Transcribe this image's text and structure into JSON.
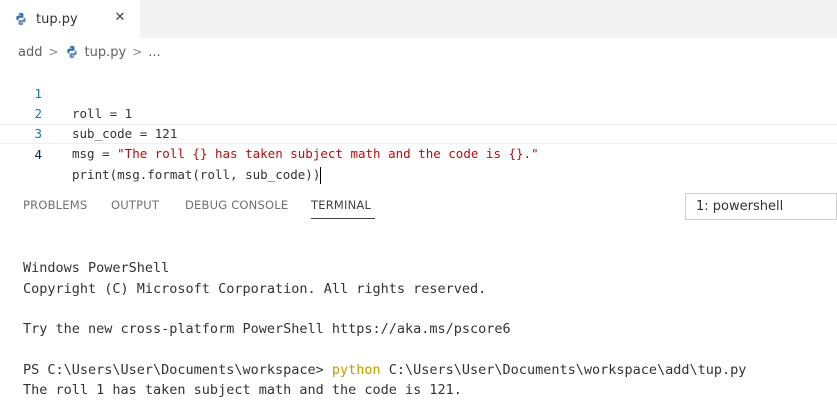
{
  "tab": {
    "filename": "tup.py",
    "close_glyph": "✕"
  },
  "breadcrumb": {
    "folder": "add",
    "file": "tup.py",
    "more": "...",
    "separator": ">"
  },
  "editor": {
    "lines": [
      {
        "number": "1",
        "code": "roll = 1"
      },
      {
        "number": "2",
        "code": "sub_code = 121"
      },
      {
        "number": "3",
        "code_prefix": "msg = ",
        "string": "\"The roll {} has taken subject math and the code is {}.\""
      },
      {
        "number": "4",
        "code": "print(msg.format(roll, sub_code))"
      }
    ]
  },
  "panel": {
    "tabs": [
      "PROBLEMS",
      "OUTPUT",
      "DEBUG CONSOLE",
      "TERMINAL"
    ],
    "active_tab": "TERMINAL",
    "terminal_selector": "1: powershell"
  },
  "terminal": {
    "line1": "Windows PowerShell",
    "line2": "Copyright (C) Microsoft Corporation. All rights reserved.",
    "line3": "Try the new cross-platform PowerShell https://aka.ms/pscore6",
    "prompt": "PS C:\\Users\\User\\Documents\\workspace> ",
    "command": "python",
    "command_arg": " C:\\Users\\User\\Documents\\workspace\\add\\tup.py",
    "output": "The roll 1 has taken subject math and the code is 121."
  },
  "colors": {
    "string": "#a31515",
    "command": "#b8a000",
    "line_number": "#237893",
    "python_blue": "#3572A5",
    "python_yellow": "#F4C534"
  },
  "icons": {
    "file_icon": "python-icon"
  }
}
